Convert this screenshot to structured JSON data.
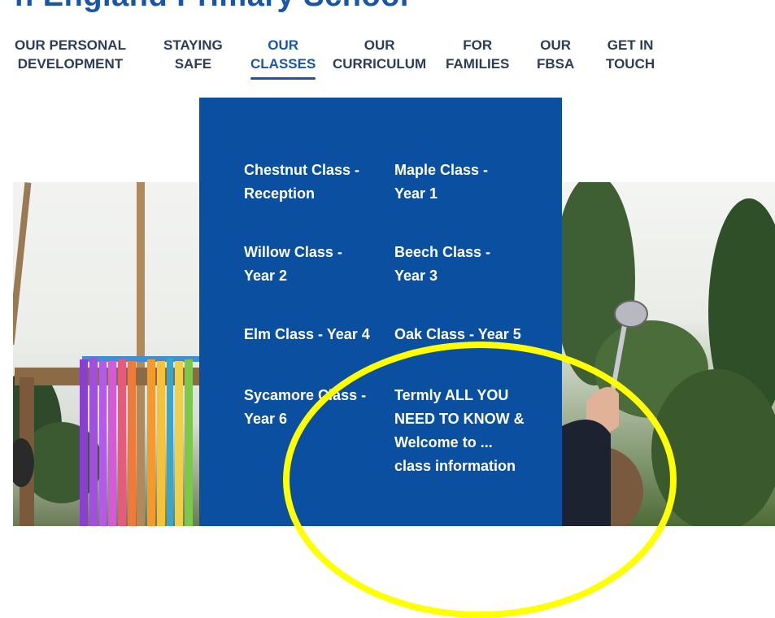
{
  "site": {
    "title": "h England Primary School"
  },
  "nav": {
    "items": [
      {
        "line1": "OUR PERSONAL",
        "line2": "DEVELOPMENT",
        "active": false
      },
      {
        "line1": "STAYING",
        "line2": "SAFE",
        "active": false
      },
      {
        "line1": "OUR",
        "line2": "CLASSES",
        "active": true
      },
      {
        "line1": "OUR",
        "line2": "CURRICULUM",
        "active": false
      },
      {
        "line1": "FOR",
        "line2": "FAMILIES",
        "active": false
      },
      {
        "line1": "OUR",
        "line2": "FBSA",
        "active": false
      },
      {
        "line1": "GET IN",
        "line2": "TOUCH",
        "active": false
      }
    ]
  },
  "dropdown": {
    "items": [
      {
        "line1": "Chestnut Class -",
        "line2": "Reception"
      },
      {
        "line1": "Maple Class -",
        "line2": "Year 1"
      },
      {
        "line1": "Willow Class -",
        "line2": "Year 2"
      },
      {
        "line1": "Beech Class -",
        "line2": "Year 3"
      },
      {
        "line1": "Elm Class - Year 4"
      },
      {
        "line1": "Oak Class - Year 5"
      },
      {
        "line1": "Sycamore Class -",
        "line2": "Year 6"
      },
      {
        "line1": "Termly ALL YOU",
        "line2": "NEED TO KNOW &",
        "line3": "Welcome to ...",
        "line4": "class information"
      }
    ]
  },
  "colors": {
    "brand_blue": "#0b4fa0",
    "nav_active": "#1a56a8",
    "nav_text": "#2c3e57",
    "highlight": "#ffff00"
  }
}
